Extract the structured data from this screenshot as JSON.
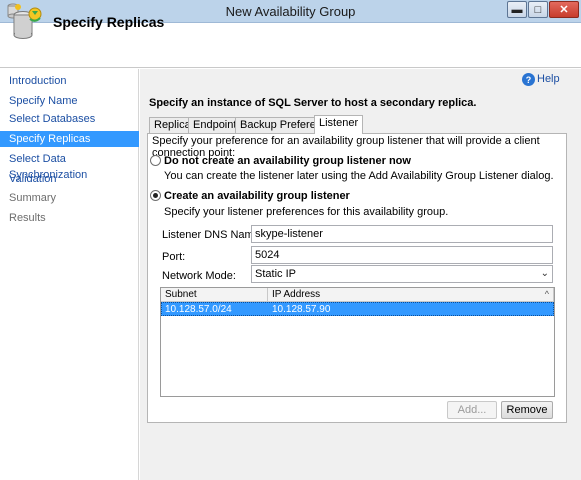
{
  "window": {
    "title": "New Availability Group",
    "minimize": "▬",
    "maximize": "□",
    "close": "✕"
  },
  "header": {
    "title": "Specify Replicas"
  },
  "sidebar": {
    "items": [
      {
        "label": "Introduction",
        "state": "link"
      },
      {
        "label": "Specify Name",
        "state": "link"
      },
      {
        "label": "Select Databases",
        "state": "link"
      },
      {
        "label": "Specify Replicas",
        "state": "active"
      },
      {
        "label": "Select Data Synchronization",
        "state": "link"
      },
      {
        "label": "Validation",
        "state": "link"
      },
      {
        "label": "Summary",
        "state": "disabled"
      },
      {
        "label": "Results",
        "state": "disabled"
      }
    ]
  },
  "help": {
    "label": "Help",
    "icon": "?"
  },
  "instruction": "Specify an instance of SQL Server to host a secondary replica.",
  "tabs": [
    {
      "label": "Replicas"
    },
    {
      "label": "Endpoints"
    },
    {
      "label": "Backup Preferences"
    },
    {
      "label": "Listener"
    }
  ],
  "active_tab": "Listener",
  "listener": {
    "intro": "Specify your preference for an availability group listener that will provide a client connection point:",
    "option_none": {
      "label": "Do not create an availability group listener now",
      "description": "You can create the listener later using the Add Availability Group Listener dialog.",
      "selected": false
    },
    "option_create": {
      "label": "Create an availability group listener",
      "description": "Specify your listener preferences for this availability group.",
      "selected": true
    },
    "dns_name": {
      "label": "Listener DNS Name:",
      "value": "skype-listener"
    },
    "port": {
      "label": "Port:",
      "value": "5024"
    },
    "network_mode": {
      "label": "Network Mode:",
      "value": "Static IP"
    },
    "grid": {
      "columns": [
        "Subnet",
        "IP Address"
      ],
      "rows": [
        {
          "subnet": "10.128.57.0/24",
          "ip_address": "10.128.57.90"
        }
      ]
    },
    "add_button": "Add...",
    "remove_button": "Remove"
  },
  "colors": {
    "selection": "#3399ff",
    "link": "#1c4fa3",
    "titlebar": "#bcd3ea"
  }
}
